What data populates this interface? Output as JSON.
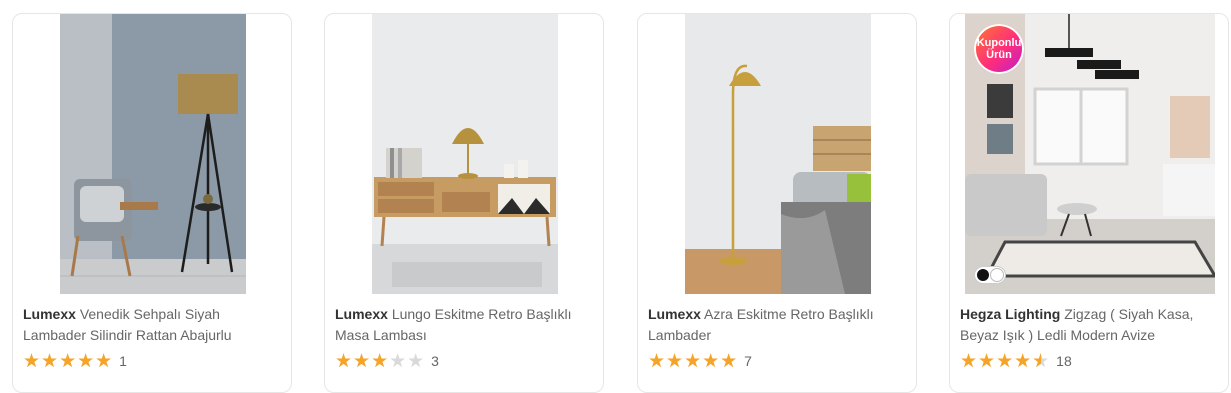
{
  "products": [
    {
      "brand": "Lumexx",
      "name": "Venedik Sehpalı Siyah Lambader Silindir Rattan Abajurlu",
      "rating": 5,
      "review_count": "1"
    },
    {
      "brand": "Lumexx",
      "name": "Lungo Eskitme Retro Başlıklı Masa Lambası",
      "rating": 3,
      "review_count": "3"
    },
    {
      "brand": "Lumexx",
      "name": "Azra Eskitme Retro Başlıklı Lambader",
      "rating": 5,
      "review_count": "7"
    },
    {
      "brand": "Hegza Lighting",
      "name": "Zigzag ( Siyah Kasa, Beyaz Işık ) Ledli Modern Avize",
      "rating": 4.5,
      "review_count": "18",
      "badge": {
        "line1": "Kuponlu",
        "line2": "Ürün"
      },
      "color_options": [
        "#111111",
        "#ffffff"
      ]
    }
  ],
  "colors": {
    "star": "#f7a325",
    "star_empty": "#d9d9d9"
  }
}
